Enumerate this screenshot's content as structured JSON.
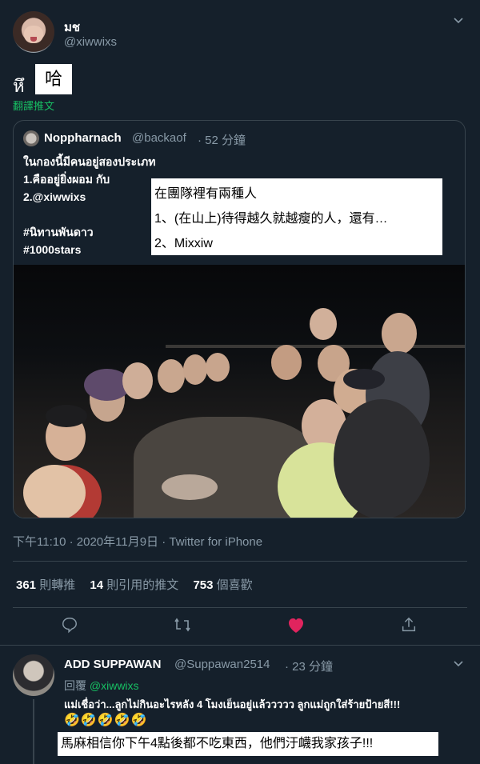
{
  "tweet": {
    "author_name": "มช",
    "author_handle": "@xiwwixs",
    "text_thai": "หึ",
    "text_overlay": "哈",
    "translate_label": "翻譯推文",
    "timestamp": "下午11:10 · 2020年11月9日 · Twitter for iPhone",
    "stats": {
      "retweets_count": "361",
      "retweets_label": "則轉推",
      "quotes_count": "14",
      "quotes_label": "則引用的推文",
      "likes_count": "753",
      "likes_label": "個喜歡"
    }
  },
  "quoted": {
    "author_name": "Noppharnach",
    "author_handle": "@backaof",
    "time": "· 52 分鐘",
    "lines": [
      "ในกองนี้มีคนอยู่สองประเภท",
      "1.คืออยู่ยิ่งผอม กับ",
      "2.@xiwwixs",
      "",
      "#นิทานพันดาว",
      "#1000stars"
    ],
    "overlay_lines": [
      "在團隊裡有兩種人",
      "1、(在山上)待得越久就越瘦的人，還有…",
      "2、Mixxiw"
    ]
  },
  "reply": {
    "author_name": "ADD SUPPAWAN",
    "author_handle": "@Suppawan2514",
    "time": "· 23 分鐘",
    "reply_prefix": "回覆",
    "reply_to": "@xiwwixs",
    "text": "แม่เชื่อว่า...ลูกไม่กินอะไรหลัง 4 โมงเย็นอยู่แล้ววววว  ลูกแม่ถูกใส่ร้ายป้ายสี!!!",
    "emojis": "🤣🤣🤣🤣🤣",
    "overlay": "馬麻相信你下午4點後都不吃東西，他們汙衊我家孩子!!!"
  },
  "colors": {
    "background": "#15202b",
    "muted": "#8899a6",
    "accent_green": "#17bf63",
    "like_red": "#e0245e",
    "divider": "#38444d"
  }
}
